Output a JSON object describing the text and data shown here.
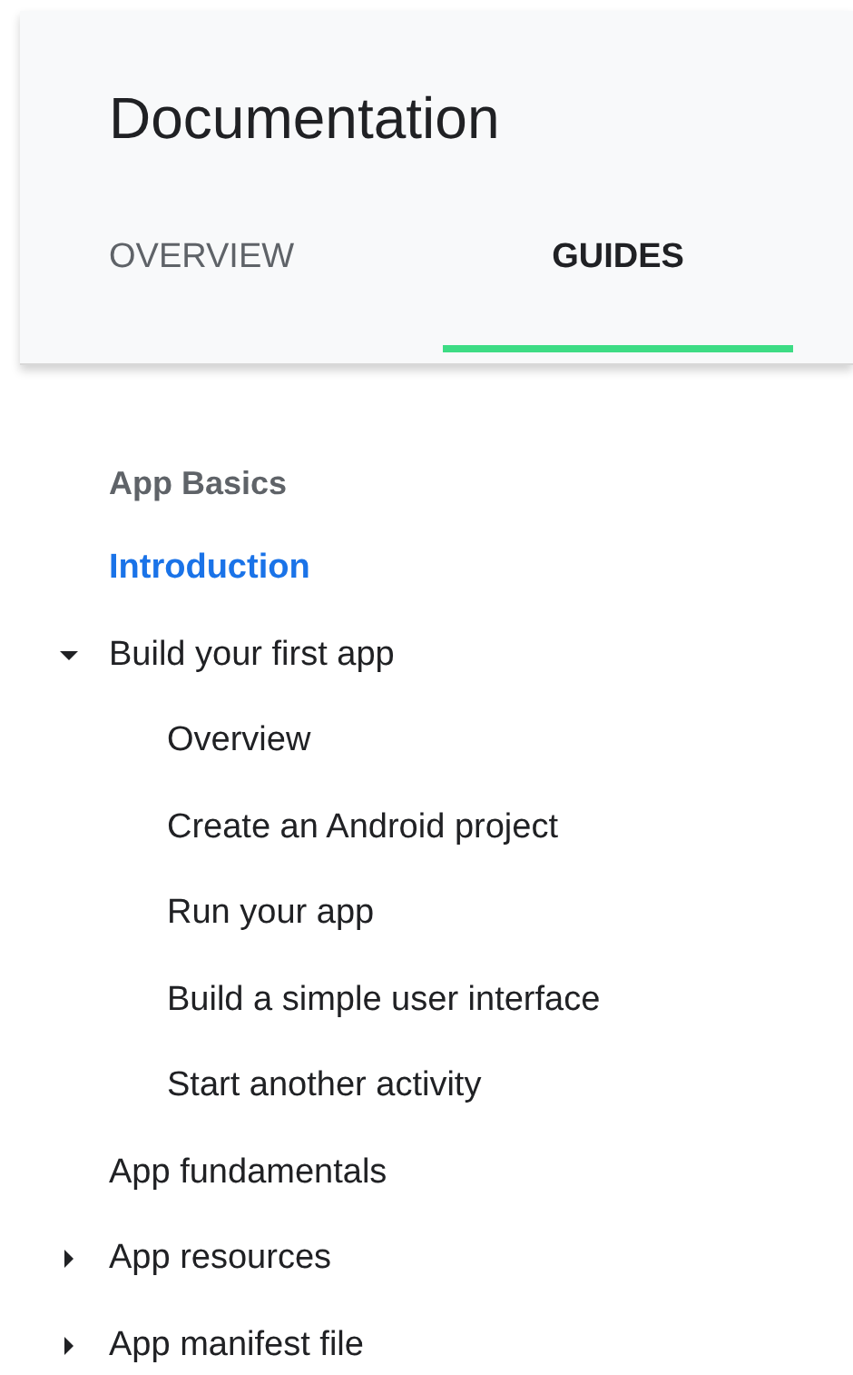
{
  "header": {
    "title": "Documentation"
  },
  "tabs": [
    {
      "label": "OVERVIEW",
      "selected": false
    },
    {
      "label": "GUIDES",
      "selected": true
    }
  ],
  "nav": {
    "heading": "App Basics",
    "items": [
      {
        "label": "Introduction",
        "selected": true
      },
      {
        "label": "Build your first app",
        "selected": false,
        "expanded": true,
        "children": [
          {
            "label": "Overview",
            "selected": false
          },
          {
            "label": "Create an Android project",
            "selected": false
          },
          {
            "label": "Run your app",
            "selected": false
          },
          {
            "label": "Build a simple user interface",
            "selected": false
          },
          {
            "label": "Start another activity",
            "selected": false
          }
        ]
      },
      {
        "label": "App fundamentals",
        "selected": false
      },
      {
        "label": "App resources",
        "selected": false,
        "expanded": false
      },
      {
        "label": "App manifest file",
        "selected": false,
        "expanded": false
      }
    ]
  }
}
